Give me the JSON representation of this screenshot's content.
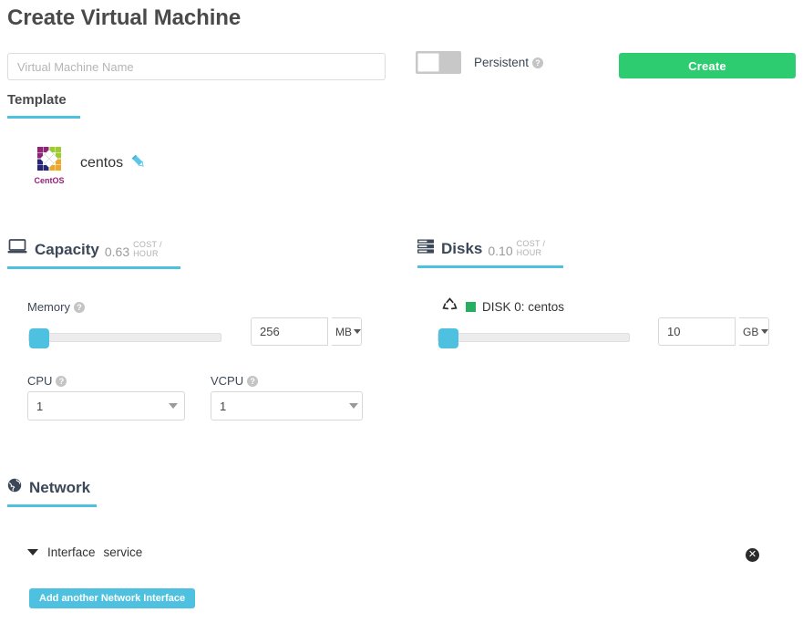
{
  "header": {
    "title": "Create Virtual Machine"
  },
  "form": {
    "name_input": {
      "value": "",
      "placeholder": "Virtual Machine Name"
    },
    "persistent": {
      "label": "Persistent",
      "help": "?",
      "state": "off"
    },
    "create_button": {
      "label": "Create"
    }
  },
  "tabs": [
    {
      "label": "Template",
      "active": true
    }
  ],
  "template": {
    "name": "centos",
    "logo_caption": "CentOS",
    "edit_icon": "pencil-icon"
  },
  "capacity": {
    "icon": "laptop-icon",
    "title": "Capacity",
    "cost": "0.63",
    "cost_unit": "COST / HOUR",
    "memory": {
      "label": "Memory",
      "help": "?",
      "value": "256",
      "unit": "MB",
      "slider_percent": 3
    },
    "cpu": {
      "label": "CPU",
      "help": "?",
      "value": "1"
    },
    "vcpu": {
      "label": "VCPU",
      "help": "?",
      "value": "1"
    }
  },
  "disks": {
    "icon": "server-stack-icon",
    "title": "Disks",
    "cost": "0.10",
    "cost_unit": "COST / HOUR",
    "items": [
      {
        "icon": "recycle-icon",
        "swatch_color": "#27ae60",
        "label": "DISK 0: centos",
        "value": "10",
        "unit": "GB",
        "slider_percent": 3
      }
    ]
  },
  "network": {
    "icon": "globe-icon",
    "title": "Network",
    "interfaces": [
      {
        "prefix": "Interface",
        "name": "service",
        "remove_icon": "close-circle-icon"
      }
    ],
    "add_button": {
      "label": "Add another Network Interface"
    }
  },
  "colors": {
    "accent": "#4fc1e0",
    "create_green": "#2ecc71",
    "disk_green": "#27ae60",
    "text_dark": "#3c4858",
    "muted": "#9b9b9b"
  }
}
